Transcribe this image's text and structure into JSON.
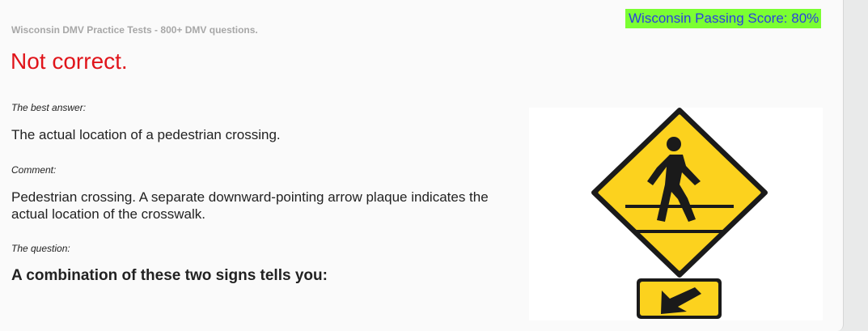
{
  "header": {
    "site_title": "Wisconsin DMV Practice Tests - 800+ DMV questions.",
    "passing_score": "Wisconsin Passing Score: 80%"
  },
  "result": {
    "status": "Not correct."
  },
  "answer": {
    "best_answer_label": "The best answer:",
    "best_answer": "The actual location of a pedestrian crossing.",
    "comment_label": "Comment:",
    "comment": "Pedestrian crossing. A separate downward-pointing arrow plaque indicates the actual location of the crosswalk."
  },
  "question": {
    "label": "The question:",
    "text": "A combination of these two signs tells you:"
  },
  "image": {
    "icons": [
      "pedestrian-crossing-sign-icon",
      "down-left-arrow-plaque-icon"
    ],
    "colors": {
      "sign_yellow": "#fcd21e",
      "sign_border": "#1a1a1a"
    }
  },
  "colors": {
    "result": "#e0141a",
    "passing_bg": "#7bff32",
    "passing_text": "#2a3fe0"
  }
}
